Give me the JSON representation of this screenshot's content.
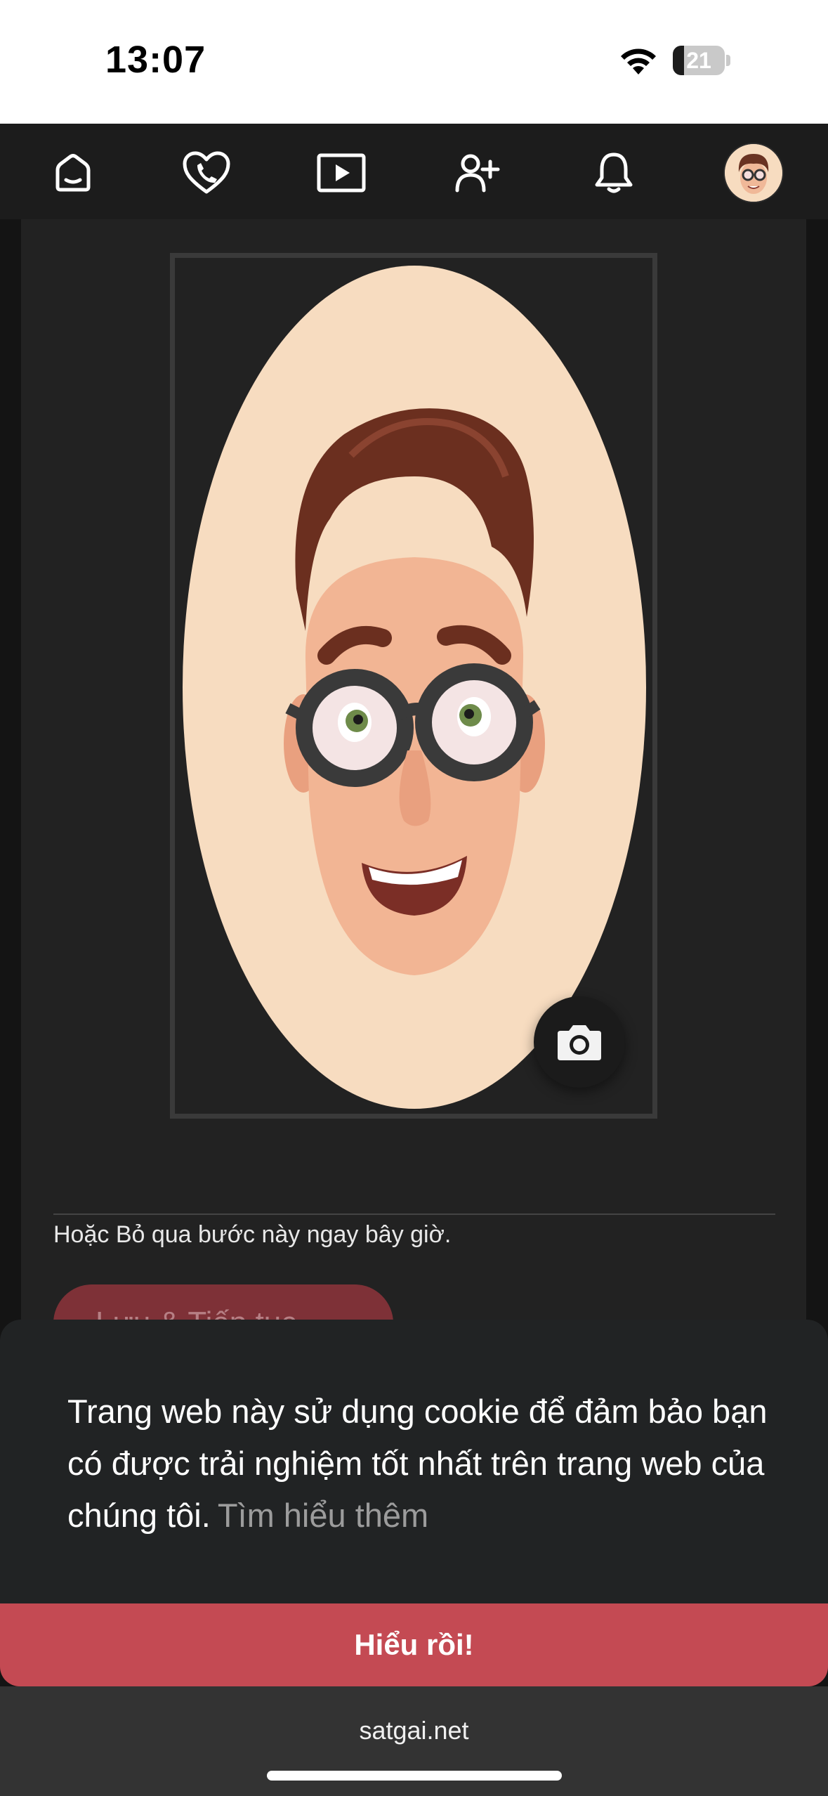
{
  "status_bar": {
    "time": "13:07",
    "battery_level": "21"
  },
  "nav": {
    "icons": [
      "home-icon",
      "heart-phone-icon",
      "video-play-icon",
      "add-user-icon",
      "bell-icon"
    ],
    "avatar": "memoji-avatar"
  },
  "profile": {
    "skip_text": "Hoặc Bỏ qua bước này ngay bây giờ.",
    "save_button": "Lưu & Tiếp tục"
  },
  "cookie_notice": {
    "message": "Trang web này sử dụng cookie để đảm bảo bạn có được trải nghiệm tốt nhất trên trang web của chúng tôi.",
    "learn_more": "Tìm hiểu thêm",
    "accept_button": "Hiểu rồi!"
  },
  "browser": {
    "url": "satgai.net"
  },
  "colors": {
    "accent": "#c44a53",
    "nav_background": "#1c1c1c",
    "page_background": "#222222",
    "avatar_background": "#f7dcc0"
  }
}
